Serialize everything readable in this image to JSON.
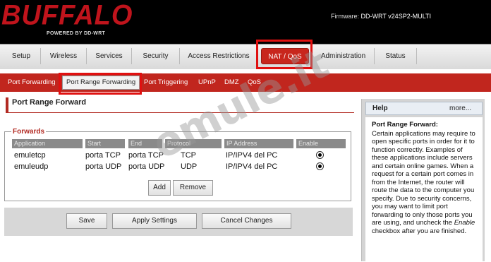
{
  "brand": {
    "logo": "BUFFALO",
    "tagline": "POWERED BY DD-WRT",
    "firmware_label": "Firmware:",
    "firmware_value": "DD-WRT v24SP2-MULTI"
  },
  "nav": {
    "tabs": [
      "Setup",
      "Wireless",
      "Services",
      "Security",
      "Access Restrictions",
      "NAT / QoS",
      "Administration",
      "Status"
    ],
    "active": "NAT / QoS"
  },
  "subnav": {
    "items": [
      "Port Forwarding",
      "Port Range Forwarding",
      "Port Triggering",
      "UPnP",
      "DMZ",
      "QoS"
    ],
    "active": "Port Range Forwarding"
  },
  "page": {
    "title": "Port Range Forward"
  },
  "forwards": {
    "legend": "Forwards",
    "columns": [
      "Application",
      "Start",
      "End",
      "Protocol",
      "IP Address",
      "Enable"
    ],
    "rows": [
      {
        "application": "emuletcp",
        "start": "porta TCP",
        "end": "porta TCP",
        "protocol": "TCP",
        "ip": "IP/IPV4 del PC",
        "enabled": true
      },
      {
        "application": "emuleudp",
        "start": "porta UDP",
        "end": "porta UDP",
        "protocol": "UDP",
        "ip": "IP/IPV4 del PC",
        "enabled": true
      }
    ],
    "add_label": "Add",
    "remove_label": "Remove"
  },
  "actions": {
    "save": "Save",
    "apply": "Apply Settings",
    "cancel": "Cancel Changes"
  },
  "help": {
    "title": "Help",
    "more": "more...",
    "subtitle": "Port Range Forward:",
    "text_before": "Certain applications may require to open specific ports in order for it to function correctly. Examples of these applications include servers and certain online games. When a request for a certain port comes in from the Internet, the router will route the data to the computer you specify. Due to security concerns, you may want to limit port forwarding to only those ports you are using, and uncheck the ",
    "text_emphasis": "Enable",
    "text_after": " checkbox after you are finished."
  },
  "watermark": "emule.it",
  "colors": {
    "brand_red": "#c1261e",
    "highlight_box": "#e01010",
    "header_bg": "#000000"
  }
}
